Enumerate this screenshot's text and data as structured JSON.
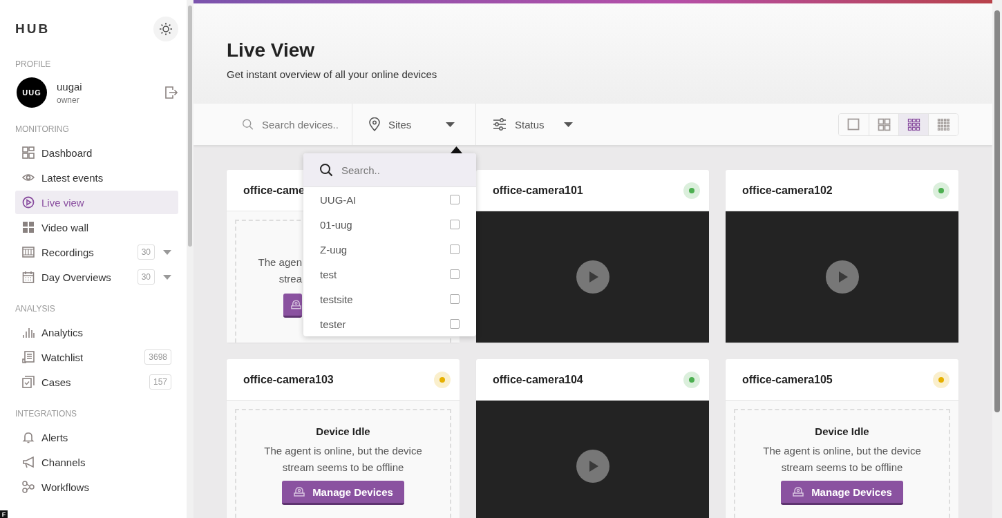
{
  "sidebar": {
    "logo": "HUB",
    "profile_heading": "PROFILE",
    "user": {
      "initials": "UUG",
      "name": "uugai",
      "role": "owner"
    },
    "sections": [
      {
        "heading": "MONITORING",
        "items": [
          {
            "label": "Dashboard",
            "selected": false
          },
          {
            "label": "Latest events",
            "selected": false
          },
          {
            "label": "Live view",
            "selected": true
          },
          {
            "label": "Video wall",
            "selected": false
          },
          {
            "label": "Recordings",
            "selected": false,
            "count": "30",
            "expanded": false
          },
          {
            "label": "Day Overviews",
            "selected": false,
            "count": "30",
            "expanded": false
          }
        ]
      },
      {
        "heading": "ANALYSIS",
        "items": [
          {
            "label": "Analytics",
            "selected": false
          },
          {
            "label": "Watchlist",
            "selected": false,
            "count": "3698"
          },
          {
            "label": "Cases",
            "selected": false,
            "count": "157"
          }
        ]
      },
      {
        "heading": "INTEGRATIONS",
        "items": [
          {
            "label": "Alerts",
            "selected": false
          },
          {
            "label": "Channels",
            "selected": false
          },
          {
            "label": "Workflows",
            "selected": false
          }
        ]
      }
    ]
  },
  "corner_badge": "F",
  "header": {
    "title": "Live View",
    "subtitle": "Get instant overview of all your online devices"
  },
  "filters": {
    "search_placeholder": "Search devices..",
    "sites": "Sites",
    "status": "Status"
  },
  "layouts": [
    {
      "selected": false
    },
    {
      "selected": false
    },
    {
      "selected": true
    },
    {
      "selected": false
    }
  ],
  "sites_dropdown": {
    "placeholder": "Search..",
    "options": [
      {
        "label": "UUG-AI",
        "checked": false
      },
      {
        "label": "01-uug",
        "checked": false
      },
      {
        "label": "Z-uug",
        "checked": false
      },
      {
        "label": "test",
        "checked": false
      },
      {
        "label": "testsite",
        "checked": false
      },
      {
        "label": "tester",
        "checked": false
      }
    ]
  },
  "cameras": [
    {
      "name": "office-came",
      "kind": "covered",
      "lines": [
        "The agen",
        "strea"
      ]
    },
    {
      "name": "office-camera101",
      "kind": "stream",
      "color": "#4caf50"
    },
    {
      "name": "office-camera102",
      "kind": "stream",
      "color": "#4caf50"
    },
    {
      "name": "office-camera103",
      "kind": "idle",
      "color": "#e6b000",
      "heading": "Device Idle",
      "lines": [
        "The agent is online, but the device",
        "stream seems to be offline"
      ],
      "button": "Manage Devices"
    },
    {
      "name": "office-camera104",
      "kind": "stream",
      "color": "#4caf50"
    },
    {
      "name": "office-camera105",
      "kind": "idle",
      "color": "#e6b000",
      "heading": "Device Idle",
      "lines": [
        "The agent is online, but the device",
        "stream seems to be offline"
      ],
      "button": "Manage Devices"
    }
  ]
}
